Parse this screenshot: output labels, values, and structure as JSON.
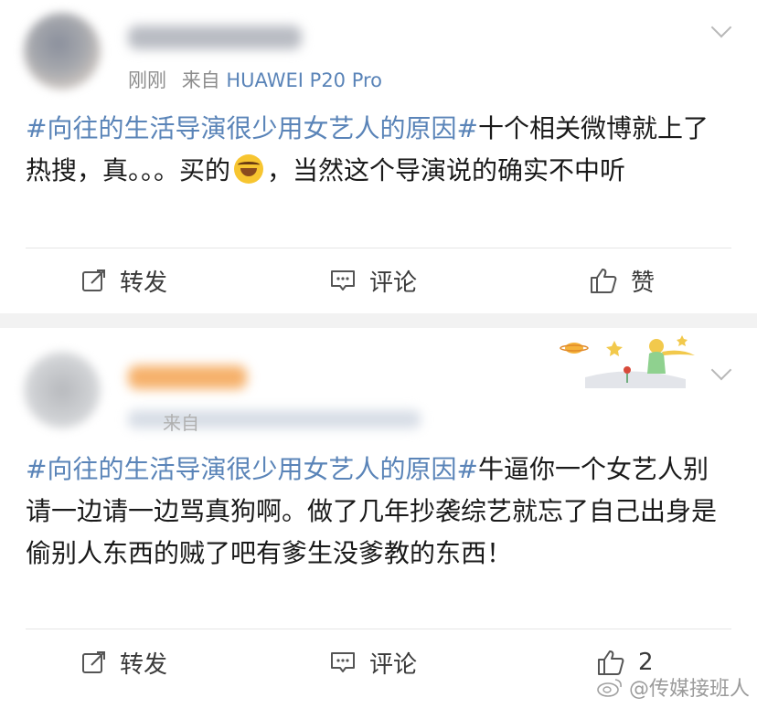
{
  "colors": {
    "link": "#5a84b8",
    "text": "#1a1a1a",
    "meta": "#8d8d8d",
    "action": "#3a3a3a"
  },
  "posts": [
    {
      "meta": {
        "time": "刚刚",
        "from_label": "来自",
        "source": "HUAWEI P20 Pro"
      },
      "topic": "#向往的生活导演很少用女艺人的原因#",
      "body_before_emoji": "十个相关微博就上了热搜，真。。。买的",
      "emoji": "laughing-tears-emoji",
      "body_after_emoji": "，当然这个导演说的确实不中听",
      "actions": {
        "repost": "转发",
        "comment": "评论",
        "like": "赞"
      }
    },
    {
      "meta": {
        "from_label": "来自"
      },
      "topic": "#向往的生活导演很少用女艺人的原因#",
      "body": "牛逼你一个女艺人别请一边请一边骂真狗啊。做了几年抄袭综艺就忘了自己出身是偷别人东西的贼了吧有爹生没爹教的东西！",
      "actions": {
        "repost": "转发",
        "comment": "评论",
        "like": "2"
      }
    }
  ],
  "watermark": "@传媒接班人"
}
